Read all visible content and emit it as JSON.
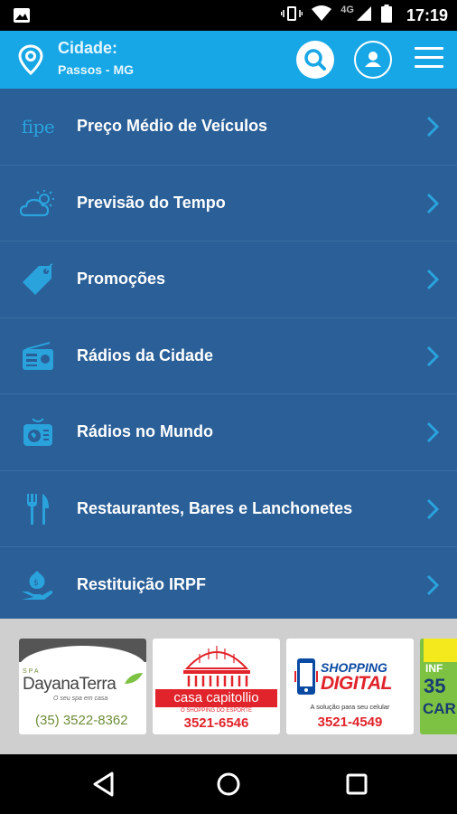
{
  "status_bar": {
    "network": "4G",
    "time": "17:19"
  },
  "header": {
    "city_label": "Cidade:",
    "city_value": "Passos - MG",
    "icons": [
      "location-pin-icon",
      "search-icon",
      "user-icon",
      "hamburger-menu-icon"
    ]
  },
  "menu": {
    "items": [
      {
        "label": "Preço Médio de Veículos",
        "icon_text": "fipe",
        "icon": "fipe-logo"
      },
      {
        "label": "Previsão do Tempo",
        "icon": "weather-icon"
      },
      {
        "label": "Promoções",
        "icon": "tag-icon"
      },
      {
        "label": "Rádios da Cidade",
        "icon": "radio-icon"
      },
      {
        "label": "Rádios no Mundo",
        "icon": "world-radio-icon"
      },
      {
        "label": "Restaurantes, Bares e Lanchonetes",
        "icon": "fork-knife-icon"
      },
      {
        "label": "Restituição IRPF",
        "icon": "money-hand-icon"
      }
    ]
  },
  "ads": [
    {
      "spa": "SPA",
      "brand": "DayanaTerra",
      "tagline": "O seu spa em casa",
      "phone": "(35) 3522-8362"
    },
    {
      "name": "casa capitollio",
      "sub": "O SHOPPING DO ESPORTE",
      "phone": "3521-6546"
    },
    {
      "line1": "SHOPPING",
      "line2": "DIGITAL",
      "sub": "A solução para seu celular",
      "phone": "3521-4549"
    },
    {
      "line1": "INF",
      "line2": "35",
      "line3": "CAR"
    }
  ],
  "colors": {
    "header": "#17a7e6",
    "list_bg": "#2a5f97",
    "accent": "#2aa3dd"
  }
}
